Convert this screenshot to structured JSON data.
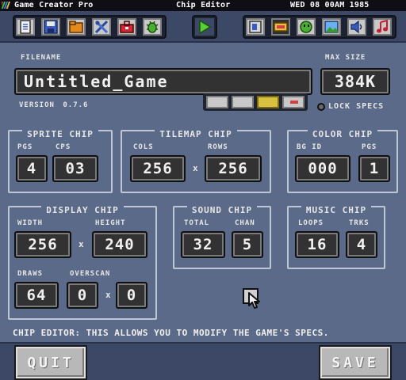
{
  "menubar": {
    "app_name": "Game Creator Pro",
    "title": "Chip Editor",
    "datetime": "WED 08 00AM 1985"
  },
  "toolbar": {
    "left_icons": [
      "document-icon",
      "floppy-disk-icon",
      "folder-icon",
      "tools-icon",
      "toolbox-icon",
      "bug-icon"
    ],
    "play_icon": "play-icon",
    "right_icons": [
      "chip-icon",
      "cartridge-icon",
      "sprite-icon",
      "image-icon",
      "speaker-icon",
      "music-note-icon"
    ]
  },
  "file": {
    "filename_label": "FILENAME",
    "filename_value": "Untitled_Game",
    "maxsize_label": "MAX SIZE",
    "maxsize_value": "384K",
    "version_label": "VERSION",
    "version_value": "0.7.6",
    "lock_label": "LOCK SPECS"
  },
  "sprite_chip": {
    "title": "SPRITE CHIP",
    "pgs_label": "PGS",
    "pgs_value": "4",
    "cps_label": "CPS",
    "cps_value": "03"
  },
  "tilemap_chip": {
    "title": "TILEMAP CHIP",
    "cols_label": "COLS",
    "cols_value": "256",
    "rows_label": "ROWS",
    "rows_value": "256"
  },
  "color_chip": {
    "title": "COLOR CHIP",
    "bgid_label": "BG ID",
    "bgid_value": "000",
    "pgs_label": "PGS",
    "pgs_value": "1"
  },
  "display_chip": {
    "title": "DISPLAY CHIP",
    "width_label": "WIDTH",
    "width_value": "256",
    "height_label": "HEIGHT",
    "height_value": "240",
    "draws_label": "DRAWS",
    "draws_value": "64",
    "overscan_label": "OVERSCAN",
    "overscan_x": "0",
    "overscan_y": "0"
  },
  "sound_chip": {
    "title": "SOUND CHIP",
    "total_label": "TOTAL",
    "total_value": "32",
    "chan_label": "CHAN",
    "chan_value": "5"
  },
  "music_chip": {
    "title": "MUSIC CHIP",
    "loops_label": "LOOPS",
    "loops_value": "16",
    "trks_label": "TRKS",
    "trks_value": "4"
  },
  "status_text": "CHIP EDITOR: THIS ALLOWS YOU TO MODIFY THE GAME'S SPECS.",
  "buttons": {
    "quit": "QUIT",
    "save": "SAVE"
  },
  "times_symbol": "x"
}
